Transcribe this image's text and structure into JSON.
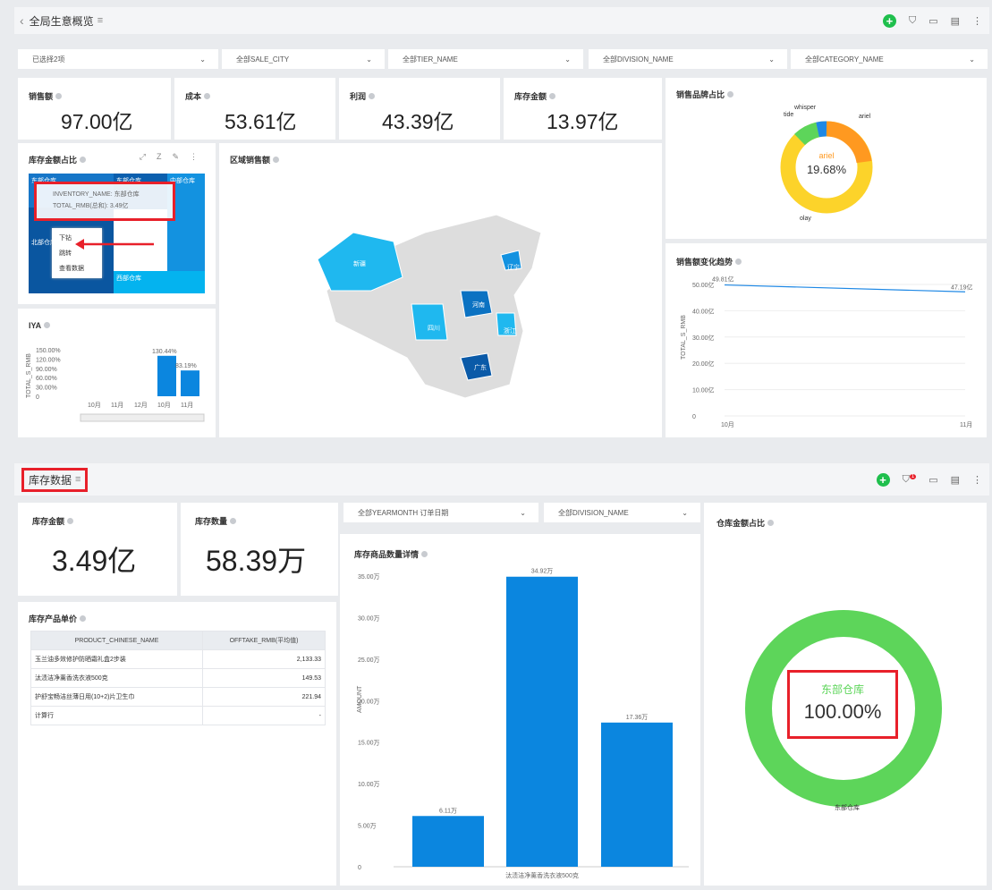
{
  "s1": {
    "title": "全局生意概览",
    "filters": [
      "已选择2项",
      "全部SALE_CITY",
      "全部TIER_NAME",
      "全部DIVISION_NAME",
      "全部CATEGORY_NAME"
    ],
    "kpis": [
      {
        "label": "销售额",
        "value": "97.00亿"
      },
      {
        "label": "成本",
        "value": "53.61亿"
      },
      {
        "label": "利润",
        "value": "43.39亿"
      },
      {
        "label": "库存金额",
        "value": "13.97亿"
      }
    ],
    "brand": {
      "title": "销售品牌占比",
      "center_label": "ariel",
      "center_value": "19.68%",
      "labels": [
        "whisper",
        "tide",
        "ariel",
        "olay"
      ]
    },
    "treemap": {
      "title": "库存金额占比",
      "tiles": [
        "东部仓库",
        "中部仓库",
        "北部仓库",
        "西部仓库"
      ],
      "tooltip_name": "INVENTORY_NAME: 东部仓库",
      "tooltip_val": "TOTAL_RMB(总和): 3.49亿",
      "menu": [
        "下钻",
        "跳转",
        "查看数据"
      ]
    },
    "map": {
      "title": "区域销售额",
      "labels": [
        "新疆",
        "西藏",
        "四川",
        "广东",
        "河南",
        "安徽",
        "辽宁",
        "浙江"
      ]
    },
    "trend": {
      "title": "销售额变化趋势",
      "ylabel": "TOTAL_S_RMB",
      "yticks": [
        "0",
        "10.00亿",
        "20.00亿",
        "30.00亿",
        "40.00亿",
        "50.00亿"
      ],
      "x": [
        "10月",
        "11月"
      ],
      "start": "49.81亿",
      "end": "47.19亿"
    },
    "iya": {
      "title": "IYA",
      "ylabel": "TOTAL_S_RMB",
      "yticks": [
        "0",
        "30.00%",
        "60.00%",
        "90.00%",
        "120.00%",
        "150.00%"
      ],
      "x": [
        "10月",
        "11月",
        "12月",
        "10月",
        "11月"
      ],
      "bars": [
        {
          "i": 3,
          "v": 130.44,
          "l": "130.44%"
        },
        {
          "i": 4,
          "v": 83.19,
          "l": "83.19%"
        }
      ]
    }
  },
  "s2": {
    "title": "库存数据",
    "badge": "1",
    "filters": [
      "全部YEARMONTH 订单日期",
      "全部DIVISION_NAME"
    ],
    "kpis": [
      {
        "label": "库存金额",
        "value": "3.49亿"
      },
      {
        "label": "库存数量",
        "value": "58.39万"
      }
    ],
    "table": {
      "title": "库存产品单价",
      "headers": [
        "PRODUCT_CHINESE_NAME",
        "OFFTAKE_RMB(平均值)"
      ],
      "rows": [
        [
          "玉兰油多效修护防晒霜礼盒2步装",
          "2,133.33"
        ],
        [
          "汰渍洁净薰香洗衣液500克",
          "149.53"
        ],
        [
          "护舒宝畅洁丝薄日用(10+2)片卫生巾",
          "221.94"
        ],
        [
          "计算行",
          "-"
        ]
      ]
    },
    "bars": {
      "title": "库存商品数量详情",
      "ylabel": "AMOUNT",
      "yticks": [
        "0",
        "5.00万",
        "10.00万",
        "15.00万",
        "20.00万",
        "25.00万",
        "30.00万",
        "35.00万"
      ],
      "values": [
        6.11,
        34.92,
        17.36
      ],
      "labels": [
        "6.11万",
        "34.92万",
        "17.36万"
      ],
      "xlabel": "汰渍洁净薰香洗衣液500克"
    },
    "donut": {
      "title": "仓库金额占比",
      "label": "东部仓库",
      "value": "100.00%",
      "legend": "东部仓库"
    }
  }
}
